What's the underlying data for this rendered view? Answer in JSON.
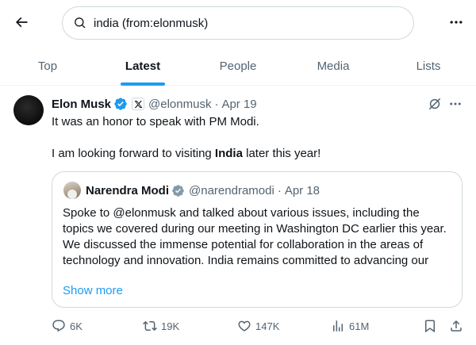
{
  "search": {
    "query": "india (from:elonmusk)"
  },
  "tabs": [
    {
      "label": "Top",
      "active": false
    },
    {
      "label": "Latest",
      "active": true
    },
    {
      "label": "People",
      "active": false
    },
    {
      "label": "Media",
      "active": false
    },
    {
      "label": "Lists",
      "active": false
    }
  ],
  "tweet": {
    "author": {
      "name": "Elon Musk",
      "handle": "@elonmusk",
      "verified_color": "#1d9bf0"
    },
    "separator": "·",
    "date": "Apr 19",
    "text_line1": "It was an honor to speak with PM Modi.",
    "text_line2_before": "I am looking forward to visiting ",
    "text_line2_bold": "India",
    "text_line2_after": " later this year!",
    "quote": {
      "author": {
        "name": "Narendra Modi",
        "handle": "@narendramodi",
        "verified_color": "#829aab"
      },
      "separator": "·",
      "date": "Apr 18",
      "text": "Spoke to @elonmusk and talked about various issues, including the topics we covered during our meeting in Washington DC earlier this year. We discussed the immense potential for collaboration in the areas of technology and innovation. India remains committed to advancing our",
      "show_more": "Show more"
    },
    "metrics": {
      "replies": "6K",
      "reposts": "19K",
      "likes": "147K",
      "views": "61M"
    }
  },
  "colors": {
    "accent": "#1d9bf0",
    "muted": "#536471",
    "border": "#cfd9de"
  },
  "icons": [
    "back-arrow-icon",
    "search-icon",
    "more-icon",
    "verified-badge-icon",
    "x-logo-icon",
    "grok-icon",
    "reply-icon",
    "repost-icon",
    "like-icon",
    "views-icon",
    "bookmark-icon",
    "share-icon"
  ]
}
